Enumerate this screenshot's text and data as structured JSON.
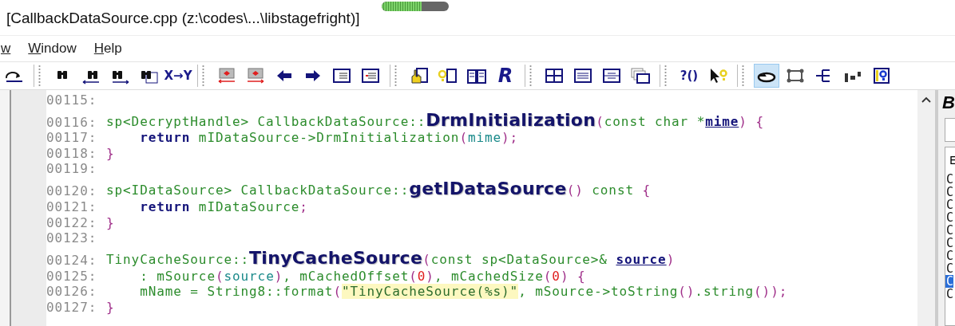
{
  "window": {
    "title": "[CallbackDataSource.cpp (z:\\codes\\...\\libstagefright)]",
    "progress": {
      "level": 0.6
    }
  },
  "menu": [
    {
      "label": "w"
    },
    {
      "label": "Window"
    },
    {
      "label": "Help"
    }
  ],
  "toolbar": [
    {
      "kind": "icon",
      "selected": false
    },
    {
      "kind": "separator"
    },
    {
      "kind": "icon",
      "selected": false
    },
    {
      "kind": "icon",
      "selected": false
    },
    {
      "kind": "icon",
      "selected": false
    },
    {
      "kind": "icon",
      "selected": false
    },
    {
      "kind": "text",
      "label": "X→Y",
      "selected": false
    },
    {
      "kind": "separator"
    },
    {
      "kind": "icon",
      "selected": false
    },
    {
      "kind": "icon",
      "selected": false
    },
    {
      "kind": "icon",
      "selected": false
    },
    {
      "kind": "icon",
      "selected": false
    },
    {
      "kind": "icon",
      "selected": false
    },
    {
      "kind": "icon",
      "selected": false
    },
    {
      "kind": "separator"
    },
    {
      "kind": "icon",
      "selected": false
    },
    {
      "kind": "icon",
      "selected": false
    },
    {
      "kind": "icon",
      "selected": false
    },
    {
      "kind": "text",
      "label": "R",
      "selected": false
    },
    {
      "kind": "separator"
    },
    {
      "kind": "icon",
      "selected": false
    },
    {
      "kind": "icon",
      "selected": false
    },
    {
      "kind": "icon",
      "selected": false
    },
    {
      "kind": "icon",
      "selected": false
    },
    {
      "kind": "separator"
    },
    {
      "kind": "text",
      "label": "?()",
      "selected": false
    },
    {
      "kind": "icon",
      "selected": false
    },
    {
      "kind": "separator"
    },
    {
      "kind": "icon",
      "selected": true
    },
    {
      "kind": "icon",
      "selected": false
    },
    {
      "kind": "icon",
      "selected": false
    },
    {
      "kind": "icon",
      "selected": false
    },
    {
      "kind": "icon",
      "selected": false
    }
  ],
  "editor": {
    "lines": [
      {
        "number": "00115:"
      },
      {
        "number": "00116:",
        "tokens": [
          {
            "kind": "ident",
            "text": "sp<DecryptHandle> CallbackDataSource::"
          },
          {
            "kind": "funcdef",
            "text": "DrmInitialization"
          },
          {
            "kind": "punct",
            "text": "("
          },
          {
            "kind": "ident",
            "text": "const char *"
          },
          {
            "kind": "paramdecl",
            "text": "mime"
          },
          {
            "kind": "punct",
            "text": ") {"
          }
        ]
      },
      {
        "number": "00117:",
        "tokens": [
          {
            "kind": "keyword",
            "text": "    return"
          },
          {
            "kind": "ident",
            "text": " mIDataSource->DrmInitialization"
          },
          {
            "kind": "punct",
            "text": "("
          },
          {
            "kind": "param",
            "text": "mime"
          },
          {
            "kind": "punct",
            "text": ");"
          }
        ]
      },
      {
        "number": "00118:",
        "tokens": [
          {
            "kind": "punct",
            "text": "}"
          }
        ]
      },
      {
        "number": "00119:"
      },
      {
        "number": "00120:",
        "tokens": [
          {
            "kind": "ident",
            "text": "sp<IDataSource> CallbackDataSource::"
          },
          {
            "kind": "funcdef",
            "text": "getIDataSource"
          },
          {
            "kind": "punct",
            "text": "()"
          },
          {
            "kind": "ident",
            "text": " const "
          },
          {
            "kind": "punct",
            "text": "{"
          }
        ]
      },
      {
        "number": "00121:",
        "tokens": [
          {
            "kind": "keyword",
            "text": "    return"
          },
          {
            "kind": "ident",
            "text": " mIDataSource"
          },
          {
            "kind": "punct",
            "text": ";"
          }
        ]
      },
      {
        "number": "00122:",
        "tokens": [
          {
            "kind": "punct",
            "text": "}"
          }
        ]
      },
      {
        "number": "00123:"
      },
      {
        "number": "00124:",
        "tokens": [
          {
            "kind": "ident",
            "text": "TinyCacheSource::"
          },
          {
            "kind": "funcdef",
            "text": "TinyCacheSource"
          },
          {
            "kind": "punct",
            "text": "("
          },
          {
            "kind": "ident",
            "text": "const sp<DataSource>& "
          },
          {
            "kind": "paramdecl",
            "text": "source"
          },
          {
            "kind": "punct",
            "text": ")"
          }
        ]
      },
      {
        "number": "00125:",
        "tokens": [
          {
            "kind": "ident",
            "text": "    : mSource"
          },
          {
            "kind": "punct",
            "text": "("
          },
          {
            "kind": "param",
            "text": "source"
          },
          {
            "kind": "punct",
            "text": ")"
          },
          {
            "kind": "ident",
            "text": ", mCachedOffset"
          },
          {
            "kind": "punct",
            "text": "("
          },
          {
            "kind": "number",
            "text": "0"
          },
          {
            "kind": "punct",
            "text": ")"
          },
          {
            "kind": "ident",
            "text": ", mCachedSize"
          },
          {
            "kind": "punct",
            "text": "("
          },
          {
            "kind": "number",
            "text": "0"
          },
          {
            "kind": "punct",
            "text": ") {"
          }
        ]
      },
      {
        "number": "00126:",
        "tokens": [
          {
            "kind": "ident",
            "text": "    mName = String8::format"
          },
          {
            "kind": "punct",
            "text": "("
          },
          {
            "kind": "string",
            "text": "\"TinyCacheSource(%s)\""
          },
          {
            "kind": "ident",
            "text": ", mSource->toString"
          },
          {
            "kind": "punct",
            "text": "()"
          },
          {
            "kind": "ident",
            "text": ".string"
          },
          {
            "kind": "punct",
            "text": "());"
          }
        ]
      },
      {
        "number": "00127:",
        "tokens": [
          {
            "kind": "punct",
            "text": "}"
          }
        ]
      }
    ]
  },
  "side_panel": {
    "title": "B",
    "label": "E",
    "items": [
      {
        "text": "C",
        "selected": false
      },
      {
        "text": "C",
        "selected": false
      },
      {
        "text": "C",
        "selected": false
      },
      {
        "text": "C",
        "selected": false
      },
      {
        "text": "C",
        "selected": false
      },
      {
        "text": "C",
        "selected": false
      },
      {
        "text": "C",
        "selected": false
      },
      {
        "text": "C",
        "selected": false
      },
      {
        "text": "C",
        "selected": true
      },
      {
        "text": "C",
        "selected": false
      }
    ]
  }
}
